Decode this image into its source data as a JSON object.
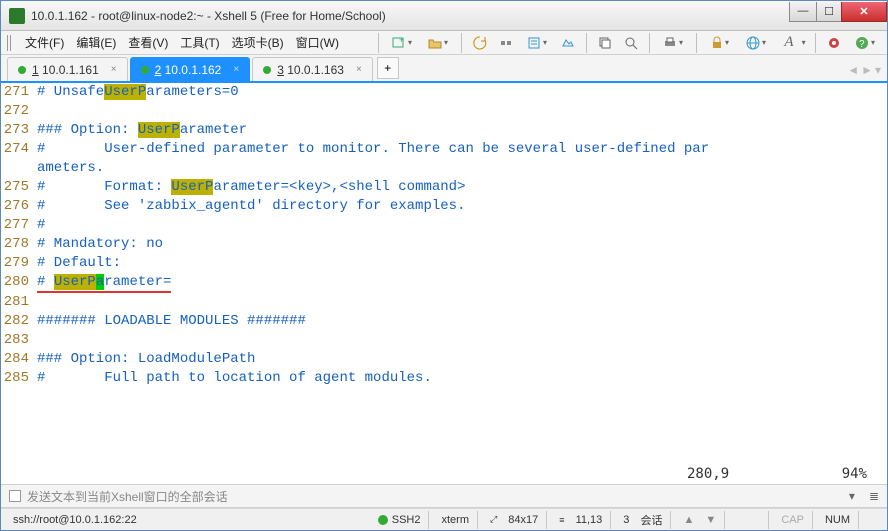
{
  "window": {
    "title": "10.0.1.162 - root@linux-node2:~ - Xshell 5 (Free for Home/School)"
  },
  "menu": {
    "file": "文件(F)",
    "edit": "编辑(E)",
    "view": "查看(V)",
    "tools": "工具(T)",
    "tab": "选项卡(B)",
    "window": "窗口(W)"
  },
  "tabs": [
    {
      "num": "1",
      "label": "10.0.1.161",
      "active": false
    },
    {
      "num": "2",
      "label": "10.0.1.162",
      "active": true
    },
    {
      "num": "3",
      "label": "10.0.1.163",
      "active": false
    }
  ],
  "addtab": "+",
  "lines": {
    "l271": {
      "n": "271",
      "a": "# Unsafe",
      "h": "UserP",
      "b": "arameters=0"
    },
    "l272": {
      "n": "272",
      "a": ""
    },
    "l273": {
      "n": "273",
      "a": "### Option: ",
      "h": "UserP",
      "b": "arameter"
    },
    "l274": {
      "n": "274",
      "a": "#       User-defined parameter to monitor. There can be several user-defined par"
    },
    "l274b": {
      "a": "ameters."
    },
    "l275": {
      "n": "275",
      "a": "#       Format: ",
      "h": "UserP",
      "b": "arameter=<key>,<shell command>"
    },
    "l276": {
      "n": "276",
      "a": "#       See 'zabbix_agentd' directory for examples."
    },
    "l277": {
      "n": "277",
      "a": "#"
    },
    "l278": {
      "n": "278",
      "a": "# Mandatory: no"
    },
    "l279": {
      "n": "279",
      "a": "# Default:"
    },
    "l280": {
      "n": "280",
      "a": "# ",
      "h": "UserP",
      "c": "a",
      "u": "rameter="
    },
    "l281": {
      "n": "281",
      "a": ""
    },
    "l282": {
      "n": "282",
      "a": "####### LOADABLE MODULES #######"
    },
    "l283": {
      "n": "283",
      "a": ""
    },
    "l284": {
      "n": "284",
      "a": "### Option: LoadModulePath"
    },
    "l285": {
      "n": "285",
      "a": "#       Full path to location of agent modules."
    }
  },
  "vimstatus": {
    "pos": "280,9",
    "pct": "94%"
  },
  "broadcast": "发送文本到当前Xshell窗口的全部会话",
  "status": {
    "conn": "ssh://root@10.0.1.162:22",
    "ssh": "SSH2",
    "term": "xterm",
    "size": "84x17",
    "cur": "11,13",
    "sess_n": "3",
    "sess_l": "会话",
    "cap": "CAP",
    "num": "NUM"
  }
}
